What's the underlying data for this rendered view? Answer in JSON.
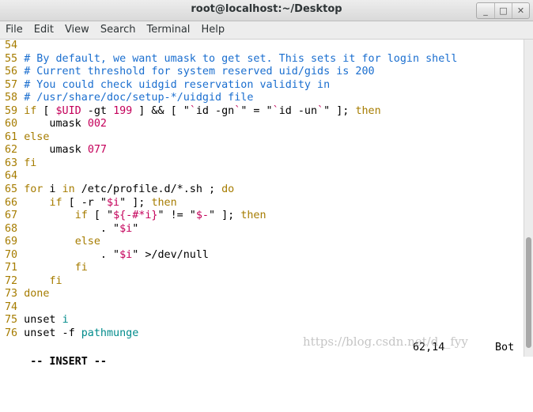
{
  "window": {
    "title": "root@localhost:~/Desktop",
    "buttons": [
      "_",
      "□",
      "✕"
    ]
  },
  "menu": [
    "File",
    "Edit",
    "View",
    "Search",
    "Terminal",
    "Help"
  ],
  "lines": [
    [
      {
        "t": "54",
        "c": "num"
      }
    ],
    [
      {
        "t": "55",
        "c": "num"
      },
      {
        "t": " "
      },
      {
        "t": "# By default, we want umask to get set. This sets it for login shell",
        "c": "c"
      }
    ],
    [
      {
        "t": "56",
        "c": "num"
      },
      {
        "t": " "
      },
      {
        "t": "# Current threshold for system reserved uid/gids is 200",
        "c": "c"
      }
    ],
    [
      {
        "t": "57",
        "c": "num"
      },
      {
        "t": " "
      },
      {
        "t": "# You could check uidgid reservation validity in",
        "c": "c"
      }
    ],
    [
      {
        "t": "58",
        "c": "num"
      },
      {
        "t": " "
      },
      {
        "t": "# /usr/share/doc/setup-*/uidgid file",
        "c": "c"
      }
    ],
    [
      {
        "t": "59",
        "c": "num"
      },
      {
        "t": " "
      },
      {
        "t": "if",
        "c": "k"
      },
      {
        "t": " [ "
      },
      {
        "t": "$UID",
        "c": "s"
      },
      {
        "t": " -gt "
      },
      {
        "t": "199",
        "c": "s"
      },
      {
        "t": " ] && [ \""
      },
      {
        "t": "`",
        "c": "s"
      },
      {
        "t": "id -gn"
      },
      {
        "t": "`",
        "c": "s"
      },
      {
        "t": "\" = \""
      },
      {
        "t": "`",
        "c": "s"
      },
      {
        "t": "id -un"
      },
      {
        "t": "`",
        "c": "s"
      },
      {
        "t": "\" ]; "
      },
      {
        "t": "then",
        "c": "k"
      }
    ],
    [
      {
        "t": "60",
        "c": "num"
      },
      {
        "t": "     umask "
      },
      {
        "t": "002",
        "c": "s"
      }
    ],
    [
      {
        "t": "61",
        "c": "num"
      },
      {
        "t": " "
      },
      {
        "t": "else",
        "c": "k"
      }
    ],
    [
      {
        "t": "62",
        "c": "num"
      },
      {
        "t": "     umask "
      },
      {
        "t": "077",
        "c": "s"
      }
    ],
    [
      {
        "t": "63",
        "c": "num"
      },
      {
        "t": " "
      },
      {
        "t": "fi",
        "c": "k"
      }
    ],
    [
      {
        "t": "64",
        "c": "num"
      }
    ],
    [
      {
        "t": "65",
        "c": "num"
      },
      {
        "t": " "
      },
      {
        "t": "for",
        "c": "k"
      },
      {
        "t": " i "
      },
      {
        "t": "in",
        "c": "k"
      },
      {
        "t": " /etc/profile.d/*.sh ; "
      },
      {
        "t": "do",
        "c": "k"
      }
    ],
    [
      {
        "t": "66",
        "c": "num"
      },
      {
        "t": "     "
      },
      {
        "t": "if",
        "c": "k"
      },
      {
        "t": " [ -r \""
      },
      {
        "t": "$i",
        "c": "s"
      },
      {
        "t": "\" ]; "
      },
      {
        "t": "then",
        "c": "k"
      }
    ],
    [
      {
        "t": "67",
        "c": "num"
      },
      {
        "t": "         "
      },
      {
        "t": "if",
        "c": "k"
      },
      {
        "t": " [ \""
      },
      {
        "t": "${-#*i}",
        "c": "s"
      },
      {
        "t": "\" != \""
      },
      {
        "t": "$-",
        "c": "s"
      },
      {
        "t": "\" ]; "
      },
      {
        "t": "then",
        "c": "k"
      }
    ],
    [
      {
        "t": "68",
        "c": "num"
      },
      {
        "t": "             . \""
      },
      {
        "t": "$i",
        "c": "s"
      },
      {
        "t": "\""
      }
    ],
    [
      {
        "t": "69",
        "c": "num"
      },
      {
        "t": "         "
      },
      {
        "t": "else",
        "c": "k"
      }
    ],
    [
      {
        "t": "70",
        "c": "num"
      },
      {
        "t": "             . \""
      },
      {
        "t": "$i",
        "c": "s"
      },
      {
        "t": "\" >/dev/null"
      }
    ],
    [
      {
        "t": "71",
        "c": "num"
      },
      {
        "t": "         "
      },
      {
        "t": "fi",
        "c": "k"
      }
    ],
    [
      {
        "t": "72",
        "c": "num"
      },
      {
        "t": "     "
      },
      {
        "t": "fi",
        "c": "k"
      }
    ],
    [
      {
        "t": "73",
        "c": "num"
      },
      {
        "t": " "
      },
      {
        "t": "done",
        "c": "k"
      }
    ],
    [
      {
        "t": "74",
        "c": "num"
      }
    ],
    [
      {
        "t": "75",
        "c": "num"
      },
      {
        "t": " unset "
      },
      {
        "t": "i",
        "c": "v"
      }
    ],
    [
      {
        "t": "76",
        "c": "num"
      },
      {
        "t": " unset -f "
      },
      {
        "t": "pathmunge",
        "c": "v"
      }
    ]
  ],
  "status": {
    "mode": "-- INSERT --",
    "position": "62,14",
    "scroll": "Bot"
  },
  "watermark": "https://blog.csdn.net/d__fyy",
  "colors": {
    "line_number": "#a67c00",
    "comment": "#1a6ecf",
    "keyword": "#a67c00",
    "string": "#c4005a",
    "variable": "#008b8b"
  }
}
